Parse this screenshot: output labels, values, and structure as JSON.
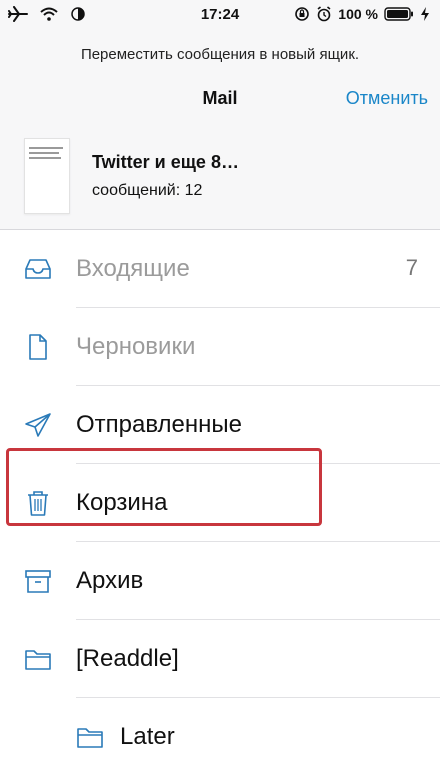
{
  "status": {
    "time": "17:24",
    "battery": "100 %",
    "icons": [
      "airplane-icon",
      "wifi-icon",
      "brightness-icon",
      "lock-rotation-icon",
      "alarm-icon",
      "battery-icon",
      "charging-icon"
    ]
  },
  "header": {
    "prompt": "Переместить сообщения в новый ящик.",
    "title": "Mail",
    "cancel_label": "Отменить"
  },
  "message": {
    "title": "Twitter и еще 8…",
    "count": "сообщений: 12"
  },
  "folders": [
    {
      "label": "Входящие",
      "count": "7",
      "icon": "inbox-tray-icon",
      "dimmed": true
    },
    {
      "label": "Черновики",
      "count": "",
      "icon": "document-icon",
      "dimmed": true
    },
    {
      "label": "Отправленные",
      "count": "",
      "icon": "paper-plane-icon",
      "dimmed": false
    },
    {
      "label": "Корзина",
      "count": "",
      "icon": "trash-icon",
      "dimmed": false,
      "highlighted": true
    },
    {
      "label": "Архив",
      "count": "",
      "icon": "archive-box-icon",
      "dimmed": false
    },
    {
      "label": "[Readdle]",
      "count": "",
      "icon": "folder-icon",
      "dimmed": false
    },
    {
      "label": "Later",
      "count": "",
      "icon": "folder-icon",
      "dimmed": false
    }
  ],
  "colors": {
    "accent": "#1a86c8",
    "highlight_border": "#c8363d",
    "icon_stroke": "#2a7ab8"
  }
}
